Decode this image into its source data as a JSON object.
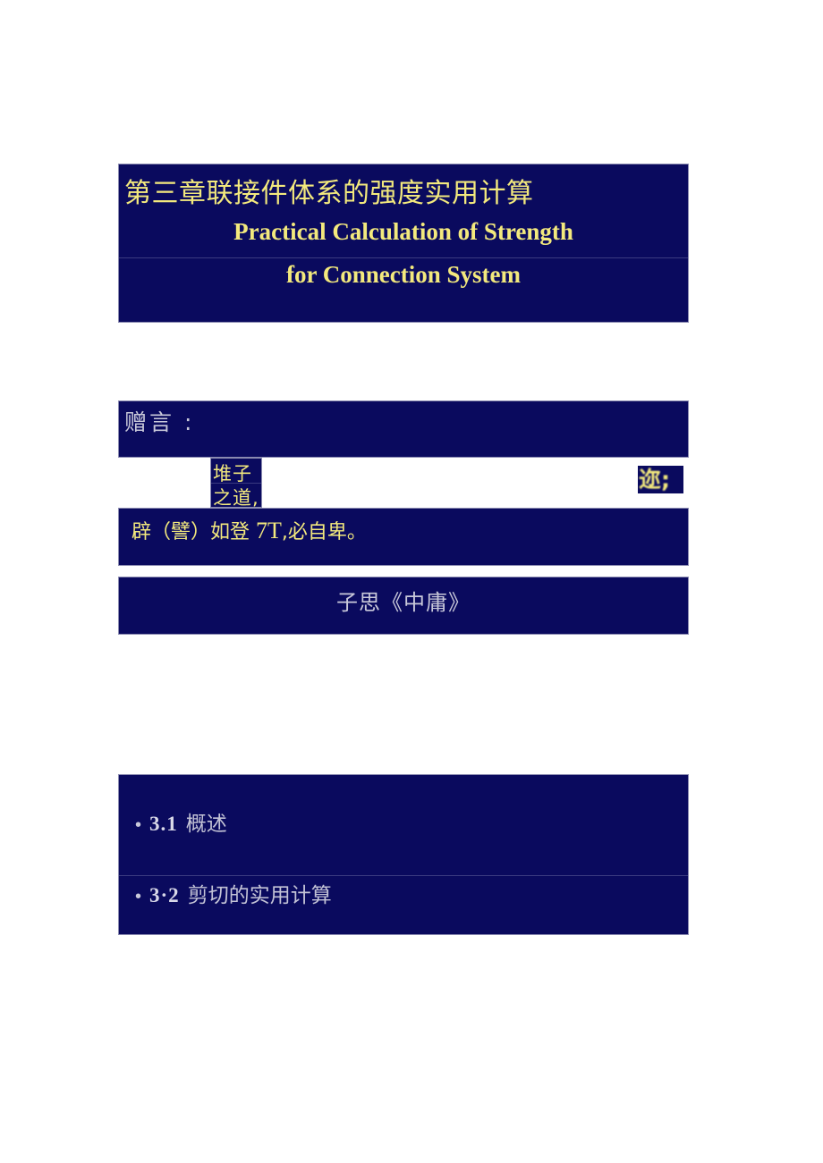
{
  "page": {
    "background_color": "#ffffff",
    "band_color": "#0a0a5e",
    "accent_yellow": "#f3e97d",
    "muted_gray": "#c9c9da"
  },
  "title": {
    "chinese": "第三章联接件体系的强度实用计算",
    "english_line1": "Practical Calculation of Strength",
    "english_line2": "for Connection System"
  },
  "dedication": {
    "label": "赠言 :"
  },
  "fragments": {
    "left": {
      "line1": "堆子",
      "line2": "之道,"
    },
    "right": {
      "text": "迩;"
    }
  },
  "quote": {
    "prefix": "辟（譬）如登",
    "garbled": "7T",
    "suffix": ",必自卑。",
    "attribution": "子思《中庸》"
  },
  "outline": {
    "items": [
      {
        "bullet": "•",
        "number": "3.1",
        "text": "概述"
      },
      {
        "bullet": "•",
        "number": "3·2",
        "text": "剪切的实用计算"
      }
    ]
  }
}
